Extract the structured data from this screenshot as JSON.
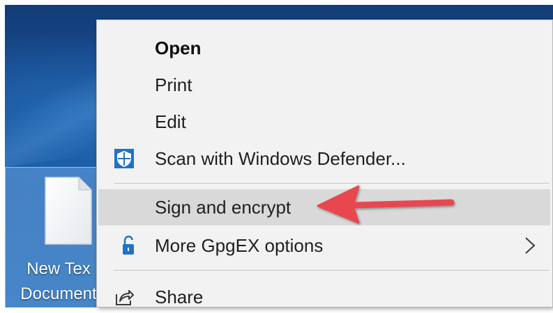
{
  "desktop": {
    "file_icon": {
      "label_line1": "New Tex",
      "label_line2": "Document"
    }
  },
  "context_menu": {
    "items": [
      {
        "label": "Open",
        "bold": true
      },
      {
        "label": "Print"
      },
      {
        "label": "Edit"
      },
      {
        "label": "Scan with Windows Defender...",
        "icon": "windows-defender-shield-icon"
      },
      {
        "label": "Sign and encrypt",
        "highlighted": true
      },
      {
        "label": "More GpgEX options",
        "icon": "padlock-icon",
        "submenu": true
      },
      {
        "label": "Share",
        "icon": "share-icon"
      }
    ]
  },
  "colors": {
    "desktop_background": "#1b5ca5",
    "menu_background": "#f2f2f2",
    "highlight": "#d9d9d9",
    "annotation_arrow": "#e8474f",
    "defender_shield": "#1e73c8",
    "padlock": "#1e73c8"
  }
}
